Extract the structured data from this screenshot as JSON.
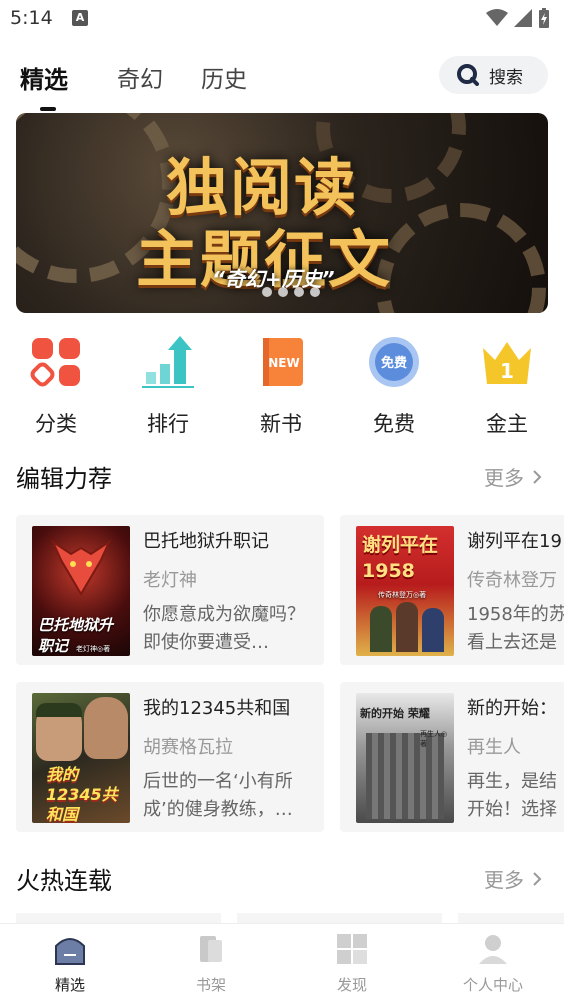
{
  "status_bar": {
    "time": "5:14",
    "a_badge": "A"
  },
  "top_tabs": [
    {
      "label": "精选",
      "active": true
    },
    {
      "label": "奇幻",
      "active": false
    },
    {
      "label": "历史",
      "active": false
    }
  ],
  "search": {
    "label": "搜索",
    "icon": "search-icon"
  },
  "banner": {
    "line1": "独阅读",
    "line2": "主题征文",
    "line3": "“奇幻+历史”",
    "dot_count": 4
  },
  "categories": [
    {
      "label": "分类",
      "icon": "category-grid-icon",
      "color": "#f0533f"
    },
    {
      "label": "排行",
      "icon": "ranking-chart-icon",
      "color": "#3cc3c4"
    },
    {
      "label": "新书",
      "icon": "new-book-icon",
      "color": "#f7823a",
      "icon_text": "NEW"
    },
    {
      "label": "免费",
      "icon": "free-badge-icon",
      "color": "#5b8ddc",
      "icon_text": "免费"
    },
    {
      "label": "金主",
      "icon": "crown-icon",
      "color": "#f5c629",
      "icon_text": "1"
    }
  ],
  "editor_picks": {
    "title": "编辑力荐",
    "more": "更多",
    "books": [
      {
        "title": "巴托地狱升职记",
        "author": "老灯神",
        "desc": "你愿意成为欲魔吗？即使你要遭受…",
        "cover_text": "巴托地狱升职记",
        "cover_sub": "老灯神◎著"
      },
      {
        "title": "谢列平在19",
        "author": "传奇林登万",
        "desc": "1958年的苏看上去还是",
        "cover_text": "谢列平在1958",
        "cover_sub": "传奇林登万◎著"
      },
      {
        "title": "我的12345共和国",
        "author": "胡赛格瓦拉",
        "desc": "后世的一名‘小有所成’的健身教练，…",
        "cover_text": "我的12345共和国",
        "cover_sub": ""
      },
      {
        "title": "新的开始：",
        "author": "再生人",
        "desc": "再生，是结开始！选择",
        "cover_text": "新的开始 荣耀",
        "cover_sub": "再生人◎著"
      }
    ]
  },
  "hot_serial": {
    "title": "火热连载",
    "more": "更多"
  },
  "bottom_nav": [
    {
      "label": "精选",
      "icon": "featured-home-icon",
      "active": true
    },
    {
      "label": "书架",
      "icon": "bookshelf-icon",
      "active": false
    },
    {
      "label": "发现",
      "icon": "discover-grid-icon",
      "active": false
    },
    {
      "label": "个人中心",
      "icon": "profile-icon",
      "active": false
    }
  ]
}
